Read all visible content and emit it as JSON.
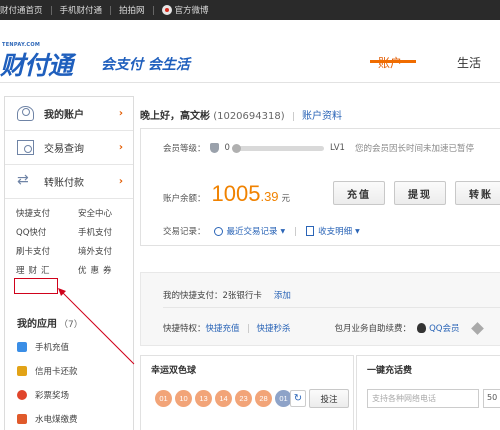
{
  "topbar": {
    "links": [
      "财付通首页",
      "手机财付通",
      "拍拍网"
    ],
    "weibo": "官方微博"
  },
  "header": {
    "logo_small": "TENPAY.COM",
    "logo_text": "财付通",
    "slogan": "会支付 会生活",
    "tabs": [
      {
        "label": "账户",
        "active": true
      },
      {
        "label": "生活",
        "active": false
      }
    ]
  },
  "sidebar": {
    "nav": [
      {
        "label": "我的账户",
        "icon": "user-icon",
        "active": true
      },
      {
        "label": "交易查询",
        "icon": "query-icon",
        "active": false
      },
      {
        "label": "转账付款",
        "icon": "transfer-icon",
        "active": false
      }
    ],
    "arrow": "›",
    "quick_links": [
      "快捷支付",
      "安全中心",
      "QQ快付",
      "手机支付",
      "刷卡支付",
      "境外支付",
      "理财汇",
      "优惠券"
    ],
    "my_apps_title": "我的应用",
    "my_apps_count": "（7）",
    "apps": [
      {
        "label": "手机充值",
        "color": "#3a8ee6"
      },
      {
        "label": "信用卡还款",
        "color": "#e2a317"
      },
      {
        "label": "彩票奖场",
        "color": "#e0452b"
      },
      {
        "label": "水电煤缴费",
        "color": "#e05a2b"
      }
    ]
  },
  "main": {
    "greeting": "晚上好，高文彬",
    "uid": "(1020694318)",
    "profile_link": "账户资料",
    "level_label": "会员等级：",
    "level_value": "0",
    "level_target": "LV1",
    "level_note": "您的会员因长时间未加速已暂停",
    "balance_label": "账户余额：",
    "balance_int": "1005",
    "balance_dec": ".39",
    "balance_unit": "元",
    "buttons": [
      "充值",
      "提现",
      "转账"
    ],
    "records_label": "交易记录：",
    "recent_link": "最近交易记录",
    "bill_link": "收支明细",
    "dropdown_arrow": "▼",
    "quickpay_text": "我的快捷支付：2张银行卡",
    "quickpay_add": "添加",
    "quick_feature_label": "快捷特权：",
    "quick_recharge": "快捷充值",
    "quick_seckill": "快捷秒杀",
    "auto_renew_label": "包月业务自助续费：",
    "qq_member": "QQ会员",
    "lottery_title": "幸运双色球",
    "lottery_balls": [
      "01",
      "10",
      "13",
      "14",
      "23",
      "28",
      "01"
    ],
    "refresh": "↻",
    "bet_label": "投注",
    "recharge_title": "一键充话费",
    "recharge_placeholder": "支持各种网络电话",
    "recharge_amount": "50"
  }
}
